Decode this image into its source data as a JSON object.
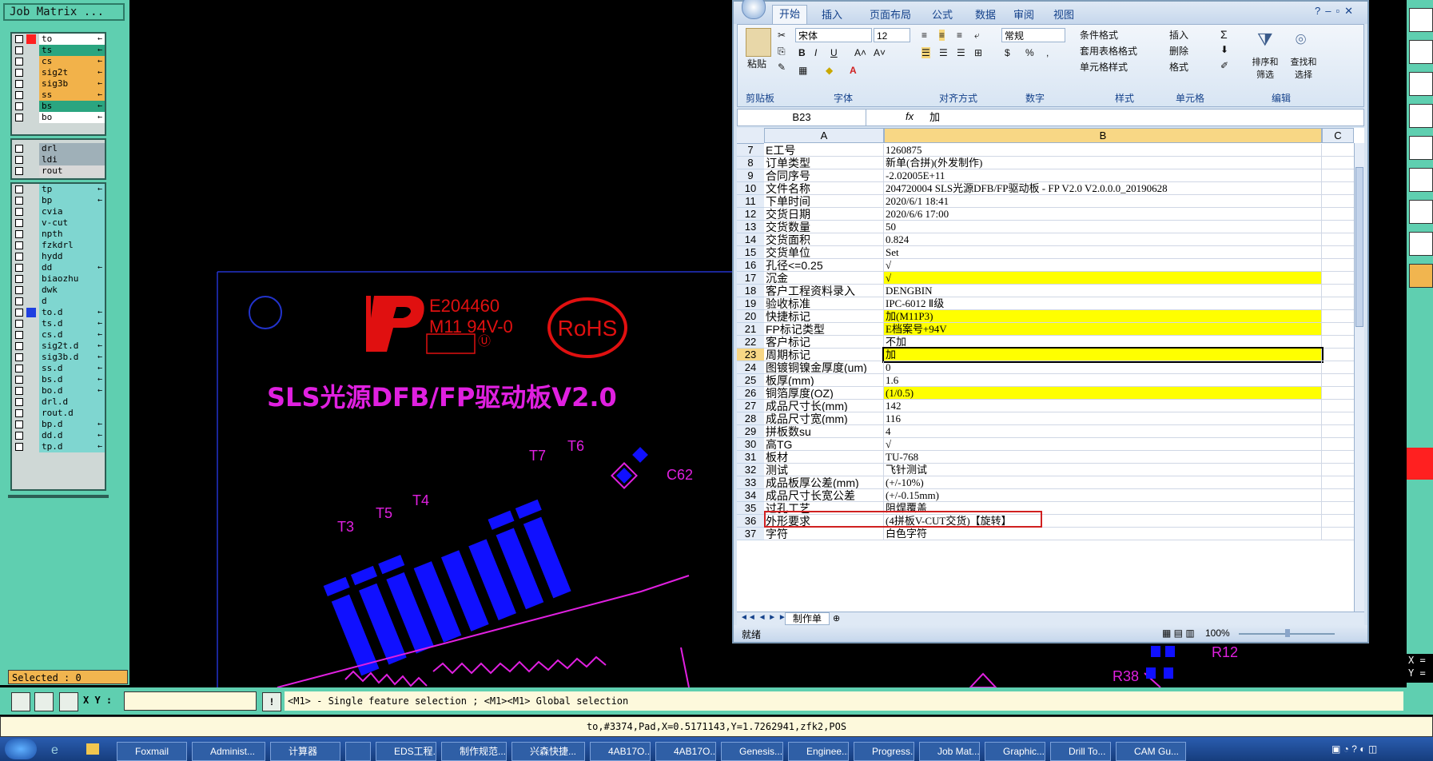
{
  "job_matrix": {
    "title": "Job Matrix ...",
    "group1": [
      {
        "name": "to",
        "color": "#ffffff",
        "mark": "#ff2020",
        "arrow": "←"
      },
      {
        "name": "ts",
        "color": "#2aa580",
        "arrow": "←"
      },
      {
        "name": "cs",
        "color": "#f2b24a",
        "arrow": "←"
      },
      {
        "name": "sig2t",
        "color": "#f2b24a",
        "arrow": "←"
      },
      {
        "name": "sig3b",
        "color": "#f2b24a",
        "arrow": "←"
      },
      {
        "name": "ss",
        "color": "#f2b24a",
        "arrow": "←"
      },
      {
        "name": "bs",
        "color": "#2aa580",
        "arrow": "←"
      },
      {
        "name": "bo",
        "color": "#ffffff",
        "arrow": "←"
      }
    ],
    "group2": [
      {
        "name": "drl",
        "color": "#9fb0b8"
      },
      {
        "name": "ldi",
        "color": "#9fb0b8"
      },
      {
        "name": "rout",
        "color": "#d8d8d8"
      }
    ],
    "group3": [
      {
        "name": "tp",
        "color": "#7fd6d0",
        "arrow": "←"
      },
      {
        "name": "bp",
        "color": "#7fd6d0",
        "arrow": "←"
      },
      {
        "name": "cvia",
        "color": "#7fd6d0"
      },
      {
        "name": "v-cut",
        "color": "#7fd6d0"
      },
      {
        "name": "npth",
        "color": "#7fd6d0"
      },
      {
        "name": "fzkdrl",
        "color": "#7fd6d0"
      },
      {
        "name": "hydd",
        "color": "#7fd6d0"
      },
      {
        "name": "dd",
        "color": "#7fd6d0",
        "arrow": "←"
      },
      {
        "name": "biaozhu",
        "color": "#7fd6d0"
      },
      {
        "name": "dwk",
        "color": "#7fd6d0"
      },
      {
        "name": "d",
        "color": "#7fd6d0"
      },
      {
        "name": "to.d",
        "color": "#7fd6d0",
        "mark": "#1f3fe0",
        "arrow": "←"
      },
      {
        "name": "ts.d",
        "color": "#7fd6d0",
        "arrow": "←"
      },
      {
        "name": "cs.d",
        "color": "#7fd6d0",
        "arrow": "←"
      },
      {
        "name": "sig2t.d",
        "color": "#7fd6d0",
        "arrow": "←"
      },
      {
        "name": "sig3b.d",
        "color": "#7fd6d0",
        "arrow": "←"
      },
      {
        "name": "ss.d",
        "color": "#7fd6d0",
        "arrow": "←"
      },
      {
        "name": "bs.d",
        "color": "#7fd6d0",
        "arrow": "←"
      },
      {
        "name": "bo.d",
        "color": "#7fd6d0",
        "arrow": "←"
      },
      {
        "name": "drl.d",
        "color": "#7fd6d0"
      },
      {
        "name": "rout.d",
        "color": "#7fd6d0"
      },
      {
        "name": "bp.d",
        "color": "#7fd6d0",
        "arrow": "←"
      },
      {
        "name": "dd.d",
        "color": "#7fd6d0",
        "arrow": "←"
      },
      {
        "name": "tp.d",
        "color": "#7fd6d0",
        "arrow": "←"
      }
    ],
    "selected_label": "Selected : 0"
  },
  "canvas": {
    "ul_code": "E204460",
    "material": "M11 94V-0",
    "rohs": "RoHS",
    "board_title": "SLS光源DFB/FP驱动板V2.0",
    "refs": [
      "T3",
      "T5",
      "T4",
      "T7",
      "T6",
      "C62",
      "R12",
      "R38"
    ]
  },
  "excel": {
    "tabs": [
      "开始",
      "插入",
      "页面布局",
      "公式",
      "数据",
      "审阅",
      "视图"
    ],
    "active_tab": "开始",
    "ribbon": {
      "paste": "粘贴",
      "font_name": "宋体",
      "font_size": "12",
      "number_format": "常规",
      "cond_format": "条件格式",
      "table_format": "套用表格格式",
      "cell_style": "单元格样式",
      "insert": "插入",
      "delete": "删除",
      "format": "格式",
      "sort": "排序和\n筛选",
      "find": "查找和\n选择",
      "groups": [
        "剪贴板",
        "字体",
        "对齐方式",
        "数字",
        "样式",
        "单元格",
        "编辑"
      ]
    },
    "name_box": "B23",
    "formula": "加",
    "col_headers": [
      "A",
      "B",
      "C"
    ],
    "rows": [
      {
        "n": "7",
        "a": "E工号",
        "b": "1260875"
      },
      {
        "n": "8",
        "a": "订单类型",
        "b": "新单(合拼)(外发制作)"
      },
      {
        "n": "9",
        "a": "合同序号",
        "b": "-2.02005E+11"
      },
      {
        "n": "10",
        "a": "文件名称",
        "b": "204720004  SLS光源DFB/FP驱动板 - FP V2.0   V2.0.0.0_20190628"
      },
      {
        "n": "11",
        "a": "下单时间",
        "b": "2020/6/1 18:41"
      },
      {
        "n": "12",
        "a": "交货日期",
        "b": "2020/6/6 17:00"
      },
      {
        "n": "13",
        "a": "交货数量",
        "b": "50"
      },
      {
        "n": "14",
        "a": "交货面积",
        "b": "0.824"
      },
      {
        "n": "15",
        "a": "交货单位",
        "b": "Set"
      },
      {
        "n": "16",
        "a": "孔径<=0.25",
        "b": "√"
      },
      {
        "n": "17",
        "a": "沉金",
        "b": "√",
        "hl": true
      },
      {
        "n": "18",
        "a": "客户工程资料录入",
        "b": "DENGBIN"
      },
      {
        "n": "19",
        "a": "验收标准",
        "b": "IPC-6012 Ⅱ级"
      },
      {
        "n": "20",
        "a": "快捷标记",
        "b": "加(M11P3)",
        "hl": true
      },
      {
        "n": "21",
        "a": "FP标记类型",
        "b": "E档案号+94V",
        "hl": true
      },
      {
        "n": "22",
        "a": "客户标记",
        "b": "不加"
      },
      {
        "n": "23",
        "a": "周期标记",
        "b": "加",
        "hl": true,
        "sel": true
      },
      {
        "n": "24",
        "a": "图镀铜镍金厚度(um)",
        "b": "0"
      },
      {
        "n": "25",
        "a": "板厚(mm)",
        "b": "1.6"
      },
      {
        "n": "26",
        "a": "铜箔厚度(OZ)",
        "b": "(1/0.5)",
        "hl": true
      },
      {
        "n": "27",
        "a": "成品尺寸长(mm)",
        "b": "142"
      },
      {
        "n": "28",
        "a": "成品尺寸宽(mm)",
        "b": "116"
      },
      {
        "n": "29",
        "a": "拼板数su",
        "b": "4"
      },
      {
        "n": "30",
        "a": "高TG",
        "b": "√"
      },
      {
        "n": "31",
        "a": "板材",
        "b": "TU-768"
      },
      {
        "n": "32",
        "a": "测试",
        "b": "飞针测试"
      },
      {
        "n": "33",
        "a": "成品板厚公差(mm)",
        "b": "(+/-10%)"
      },
      {
        "n": "34",
        "a": "成品尺寸长宽公差",
        "b": "(+/-0.15mm)"
      },
      {
        "n": "35",
        "a": "过孔工艺",
        "b": "阻焊覆盖"
      },
      {
        "n": "36",
        "a": "外形要求",
        "b": "(4拼板V-CUT交货)【旋转】"
      },
      {
        "n": "37",
        "a": "字符",
        "b": "白色字符"
      }
    ],
    "sheet_tab": "制作单",
    "status": "就绪",
    "zoom": "100%"
  },
  "cmd": {
    "xy_label": "X Y :",
    "xy_value": "",
    "hint": "<M1> - Single feature selection ; <M1><M1> Global selection"
  },
  "coords": "to,#3374,Pad,X=0.5171143,Y=1.7262941,zfk2,POS",
  "right_readout": {
    "x": "X =",
    "y": "Y ="
  },
  "taskbar": [
    "Foxmail",
    "Administ...",
    "计算器",
    "",
    "EDS工程...",
    "制作规范...",
    "兴森快捷...",
    "4AB17O...",
    "4AB17O...",
    "Genesis...",
    "Enginee...",
    "Progress...",
    "Job Mat...",
    "Graphic...",
    "Drill To...",
    "CAM Gu..."
  ],
  "colors": {
    "highlight": "#ffff00",
    "annotation_red": "#d02020"
  }
}
